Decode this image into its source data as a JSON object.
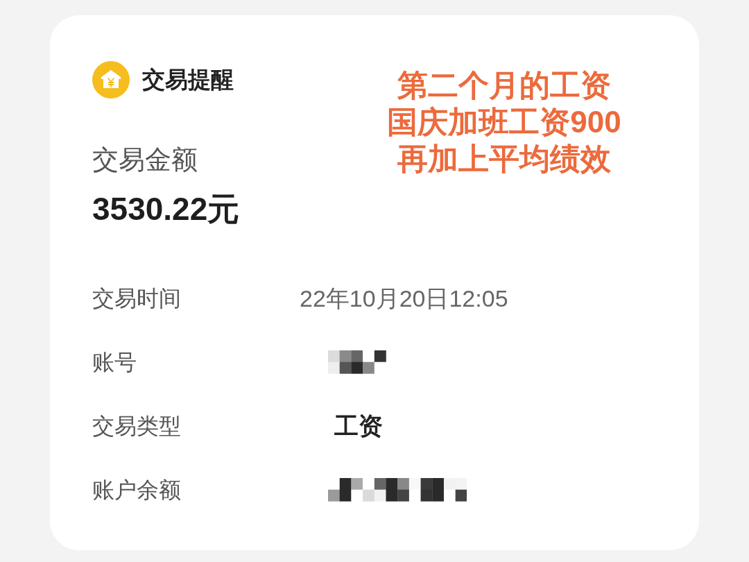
{
  "card": {
    "header": {
      "title": "交易提醒"
    },
    "amount_label": "交易金额",
    "amount": "3530.22元",
    "annotation": {
      "lines": [
        "第二个月的工资",
        "国庆加班工资900",
        "再加上平均绩效"
      ]
    },
    "details": [
      {
        "kind": "text",
        "label": "交易时间",
        "value": "22年10月20日12:05"
      },
      {
        "kind": "redacted",
        "label": "账号"
      },
      {
        "kind": "emphasis",
        "label": "交易类型",
        "value": "工资"
      },
      {
        "kind": "redacted",
        "label": "账户余额"
      }
    ]
  }
}
